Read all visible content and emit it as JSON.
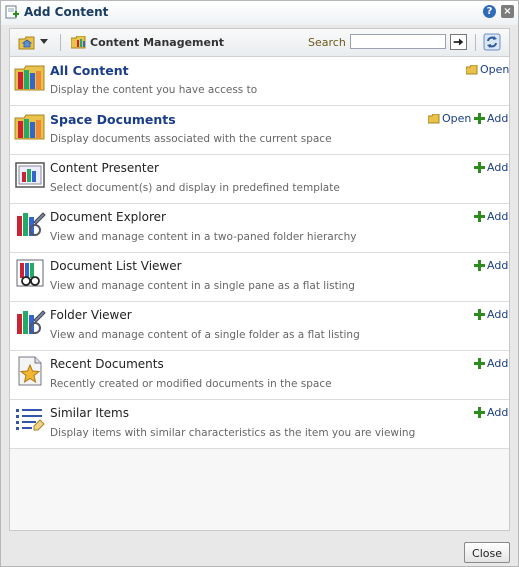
{
  "dialog": {
    "title": "Add Content",
    "help_glyph": "?",
    "close_glyph": "×",
    "icon": "add-content-icon"
  },
  "toolbar": {
    "home_icon": "home-folder-icon",
    "location_label": "Content Management",
    "search_label": "Search",
    "search_value": "",
    "search_placeholder": "",
    "go_icon": "arrow-right-icon",
    "refresh_icon": "refresh-icon"
  },
  "items": [
    {
      "title": "All Content",
      "desc": "Display the content you have access to",
      "icon": "books-folder-icon",
      "open": "Open",
      "add": ""
    },
    {
      "title": "Space Documents",
      "desc": "Display documents associated with the current space",
      "icon": "books-folder-icon",
      "open": "Open",
      "add": "Add"
    },
    {
      "title": "Content Presenter",
      "desc": "Select document(s) and display in predefined template",
      "icon": "presenter-icon",
      "open": "",
      "add": "Add"
    },
    {
      "title": "Document Explorer",
      "desc": "View and manage content in a two-paned folder hierarchy",
      "icon": "explorer-icon",
      "open": "",
      "add": "Add"
    },
    {
      "title": "Document List Viewer",
      "desc": "View and manage content in a single pane as a flat listing",
      "icon": "list-viewer-icon",
      "open": "",
      "add": "Add"
    },
    {
      "title": "Folder Viewer",
      "desc": "View and manage content of a single folder as a flat listing",
      "icon": "folder-viewer-icon",
      "open": "",
      "add": "Add"
    },
    {
      "title": "Recent Documents",
      "desc": "Recently created or modified documents in the space",
      "icon": "star-document-icon",
      "open": "",
      "add": "Add"
    },
    {
      "title": "Similar Items",
      "desc": "Display items with similar characteristics as the item you are viewing",
      "icon": "similar-items-icon",
      "open": "",
      "add": "Add"
    }
  ],
  "footer": {
    "close_label": "Close"
  },
  "colors": {
    "link": "#1a3d8a",
    "add_green": "#2e8b1e",
    "folder_yellow": "#e8c24a"
  }
}
